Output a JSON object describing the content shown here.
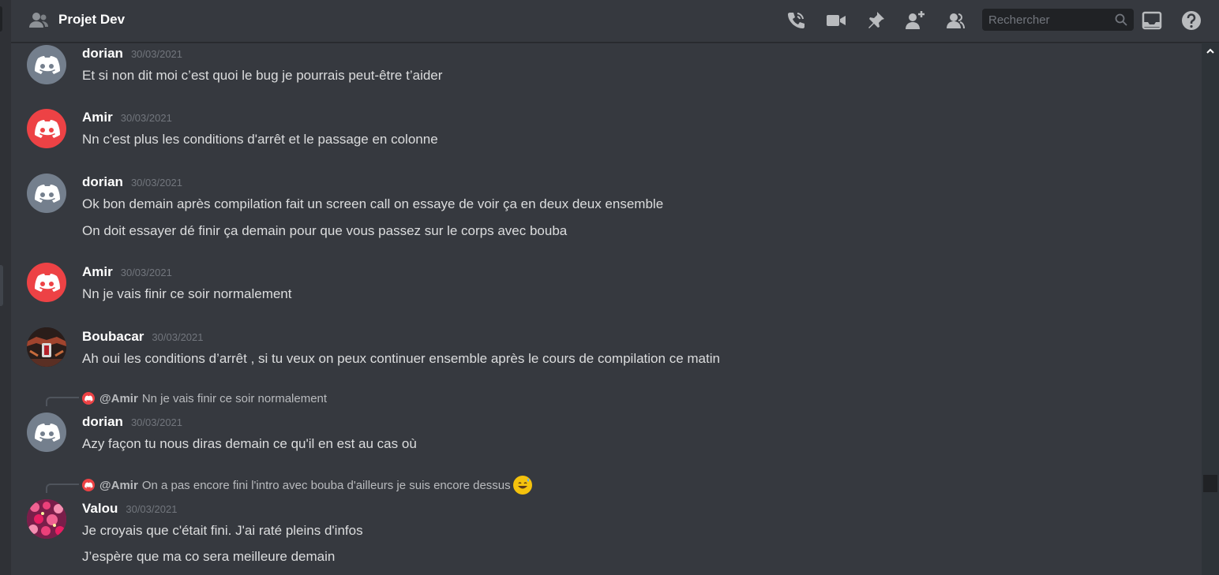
{
  "header": {
    "title": "Projet Dev",
    "search_placeholder": "Rechercher",
    "icons": [
      "members-icon",
      "call-icon",
      "video-icon",
      "pin-icon",
      "add-member-icon",
      "member-list-icon",
      "search-icon",
      "inbox-icon",
      "help-icon"
    ]
  },
  "colors": {
    "background": "#36393f",
    "gray_avatar": "#747f8d",
    "red_avatar": "#ed4245",
    "mention_line": "#4f545c"
  },
  "messages": [
    {
      "author": "dorian",
      "time": "30/03/2021",
      "avatar": "gray",
      "lines": [
        "Et si non dit moi c’est quoi le bug je pourrais peut-être t’aider"
      ]
    },
    {
      "author": "Amir",
      "time": "30/03/2021",
      "avatar": "red",
      "lines": [
        "Nn c'est plus les conditions d'arrêt et le passage en colonne"
      ]
    },
    {
      "author": "dorian",
      "time": "30/03/2021",
      "avatar": "gray",
      "lines": [
        "Ok bon demain après compilation fait un screen call on essaye de voir ça en deux deux ensemble",
        "On doit essayer dé finir ça demain pour que vous passez sur le corps avec bouba"
      ]
    },
    {
      "author": "Amir",
      "time": "30/03/2021",
      "avatar": "red",
      "lines": [
        "Nn je vais finir ce soir normalement"
      ]
    },
    {
      "author": "Boubacar",
      "time": "30/03/2021",
      "avatar": "image",
      "lines": [
        "Ah oui les conditions d’arrêt , si tu veux on peux continuer ensemble après le cours de compilation ce matin"
      ]
    },
    {
      "author": "dorian",
      "time": "30/03/2021",
      "avatar": "gray",
      "reply": {
        "mention": "@Amir",
        "text": "Nn je vais finir ce soir normalement"
      },
      "lines": [
        "Azy façon tu nous diras demain ce qu'il en est au cas où"
      ]
    },
    {
      "author": "Valou",
      "time": "30/03/2021",
      "avatar": "flowers",
      "reply": {
        "mention": "@Amir",
        "text": "On a pas encore fini l'intro avec bouba d'ailleurs je suis encore dessus",
        "emoji": "sweat-smile-emoji"
      },
      "lines": [
        "Je croyais que c'était fini. J'ai raté pleins d'infos",
        "J’espère que ma co sera meilleure demain"
      ]
    }
  ]
}
